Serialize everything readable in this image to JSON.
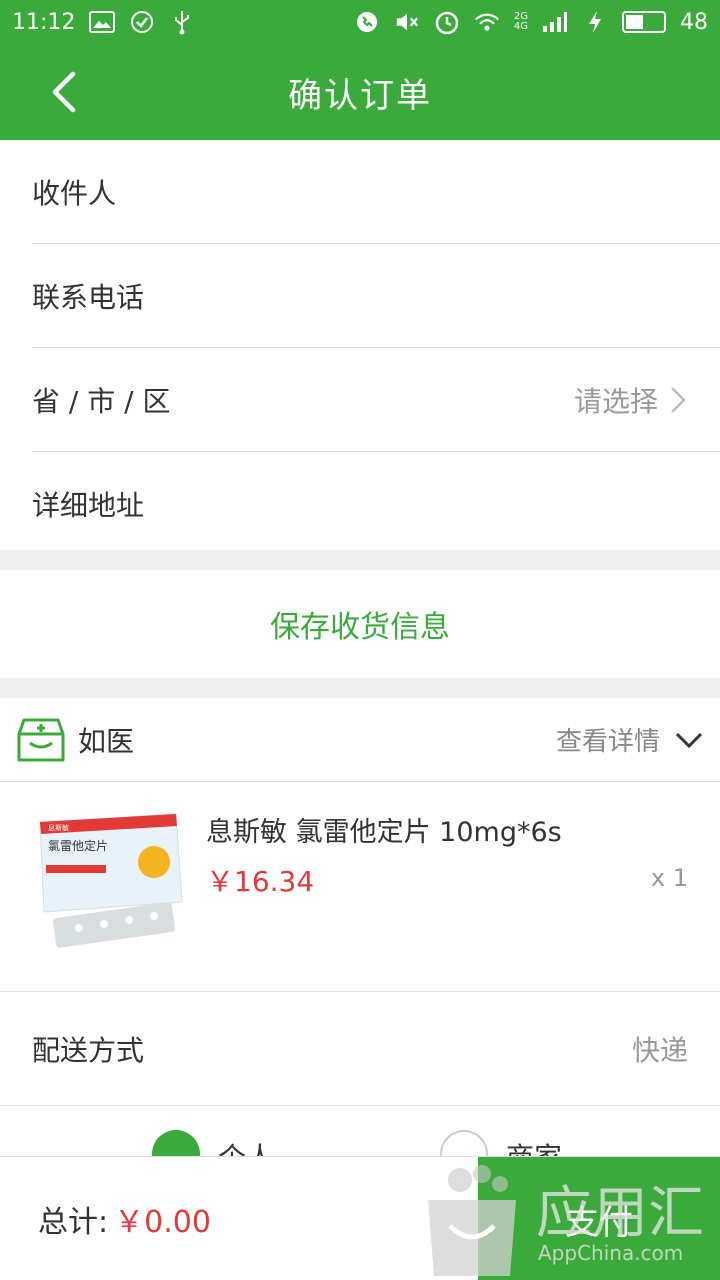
{
  "status_bar": {
    "time": "11:12",
    "battery_level": "48",
    "battery_fraction": 0.48,
    "net_top": "2G",
    "net_bottom": "4G"
  },
  "header": {
    "title": "确认订单"
  },
  "form": {
    "rows": [
      {
        "label": "收件人",
        "value": ""
      },
      {
        "label": "联系电话",
        "value": ""
      },
      {
        "label": "省 / 市 / 区",
        "value": "请选择"
      },
      {
        "label": "详细地址",
        "value": ""
      }
    ],
    "save_label": "保存收货信息"
  },
  "store": {
    "name": "如医",
    "detail_label": "查看详情"
  },
  "product": {
    "name": "息斯敏 氯雷他定片 10mg*6s",
    "price": "￥16.34",
    "quantity": "x 1",
    "box_brand": "息斯敏",
    "box_title": "氯雷他定片"
  },
  "delivery": {
    "label": "配送方式",
    "value": "快递"
  },
  "pickup_options": [
    {
      "label": "个人",
      "selected": true
    },
    {
      "label": "商家",
      "selected": false
    }
  ],
  "footer": {
    "total_label": "总计:",
    "total_amount": "￥0.00",
    "pay_label": "支付"
  },
  "watermark": {
    "text": "应用汇",
    "subtext": "AppChina.com"
  },
  "colors": {
    "brand_green": "#3aaa3a",
    "price_red": "#e03a3a"
  }
}
